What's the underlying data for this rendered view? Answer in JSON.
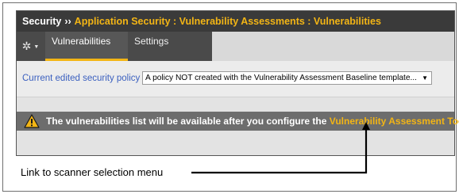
{
  "titlebar": {
    "root": "Security",
    "separator": "››",
    "path": "Application Security : Vulnerability Assessments : Vulnerabilities"
  },
  "tabs": [
    {
      "label": "Vulnerabilities",
      "active": true
    },
    {
      "label": "Settings",
      "active": false
    }
  ],
  "policy": {
    "label": "Current edited security policy",
    "selected": "A policy NOT created with the Vulnerability Assessment Baseline template..."
  },
  "notice": {
    "message": "The vulnerabilities list will be available after you configure the",
    "link": "Vulnerability Assessment Tool"
  },
  "callout": {
    "text": "Link to scanner selection menu"
  },
  "colors": {
    "accent": "#f3b515",
    "title_bar": "#3a3a3a",
    "notice_bar": "#6d6d6d",
    "policy_label": "#3a5fbf"
  }
}
